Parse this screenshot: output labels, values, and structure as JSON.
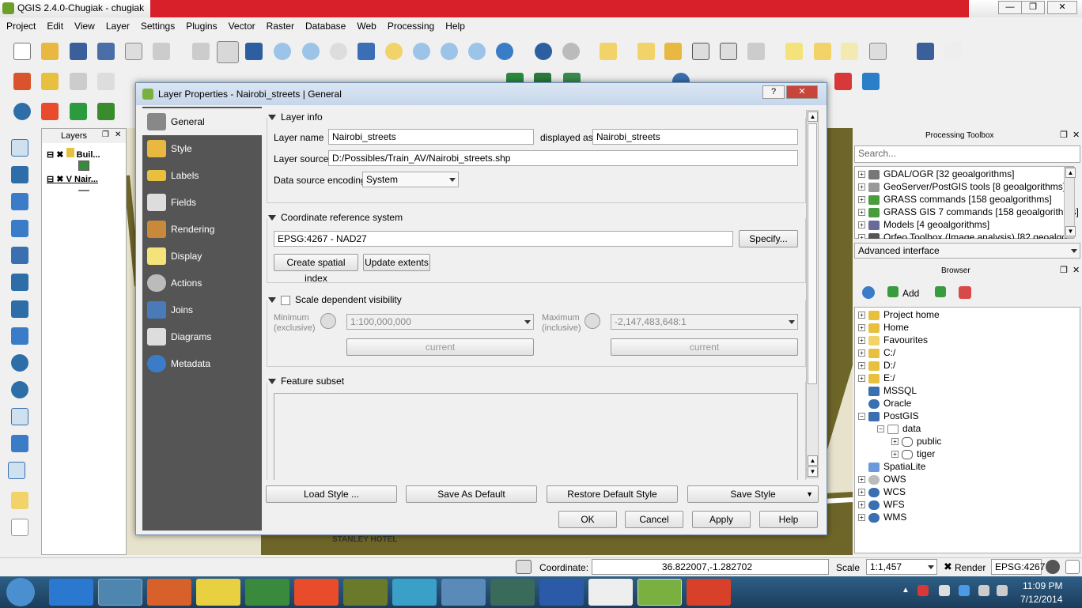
{
  "window": {
    "title": "QGIS 2.4.0-Chugiak - chugiak"
  },
  "menu": [
    "Project",
    "Edit",
    "View",
    "Layer",
    "Settings",
    "Plugins",
    "Vector",
    "Raster",
    "Database",
    "Web",
    "Processing",
    "Help"
  ],
  "layers_panel": {
    "title": "Layers",
    "items": [
      {
        "name": "Buil..."
      },
      {
        "name": "Nair..."
      }
    ]
  },
  "dialog": {
    "title": "Layer Properties - Nairobi_streets | General",
    "nav": [
      "General",
      "Style",
      "Labels",
      "Fields",
      "Rendering",
      "Display",
      "Actions",
      "Joins",
      "Diagrams",
      "Metadata"
    ],
    "layer_info": {
      "title": "Layer info",
      "name_label": "Layer name",
      "name_value": "Nairobi_streets",
      "displayed_as_label": "displayed as",
      "displayed_as_value": "Nairobi_streets",
      "source_label": "Layer source",
      "source_value": "D:/Possibles/Train_AV/Nairobi_streets.shp",
      "encoding_label": "Data source encoding",
      "encoding_value": "System"
    },
    "crs": {
      "title": "Coordinate reference system",
      "value": "EPSG:4267 - NAD27",
      "specify": "Specify...",
      "create_index": "Create spatial index",
      "update_extents": "Update extents"
    },
    "scale": {
      "title": "Scale dependent visibility",
      "min_label": "Minimum",
      "min_sub": "(exclusive)",
      "min_value": "1:100,000,000",
      "max_label": "Maximum",
      "max_sub": "(inclusive)",
      "max_value": "-2,147,483,648:1",
      "current": "current"
    },
    "subset": {
      "title": "Feature subset"
    },
    "buttons": {
      "load_style": "Load Style ...",
      "save_default": "Save As Default",
      "restore_default": "Restore Default Style",
      "save_style": "Save Style",
      "ok": "OK",
      "cancel": "Cancel",
      "apply": "Apply",
      "help": "Help"
    }
  },
  "processing": {
    "title": "Processing Toolbox",
    "search_placeholder": "Search...",
    "items": [
      "GDAL/OGR [32 geoalgorithms]",
      "GeoServer/PostGIS tools [8 geoalgorithms]",
      "GRASS commands [158 geoalgorithms]",
      "GRASS GIS 7 commands [158 geoalgorithms]",
      "Models [4 geoalgorithms]",
      "Orfeo Toolbox (Image analysis) [82 geoalgo"
    ],
    "mode": "Advanced interface"
  },
  "browser": {
    "title": "Browser",
    "add_label": "Add",
    "items": [
      "Project home",
      "Home",
      "Favourites",
      "C:/",
      "D:/",
      "E:/",
      "MSSQL",
      "Oracle",
      "PostGIS",
      "data",
      "public",
      "tiger",
      "SpatiaLite",
      "OWS",
      "WCS",
      "WFS",
      "WMS"
    ]
  },
  "map_labels": [
    "STANLEY HOTEL"
  ],
  "statusbar": {
    "coordinate_label": "Coordinate:",
    "coordinate_value": "36.822007,-1.282702",
    "scale_label": "Scale",
    "scale_value": "1:1,457",
    "render_label": "Render",
    "epsg": "EPSG:4267"
  },
  "clock": {
    "time": "11:09 PM",
    "date": "7/12/2014"
  }
}
